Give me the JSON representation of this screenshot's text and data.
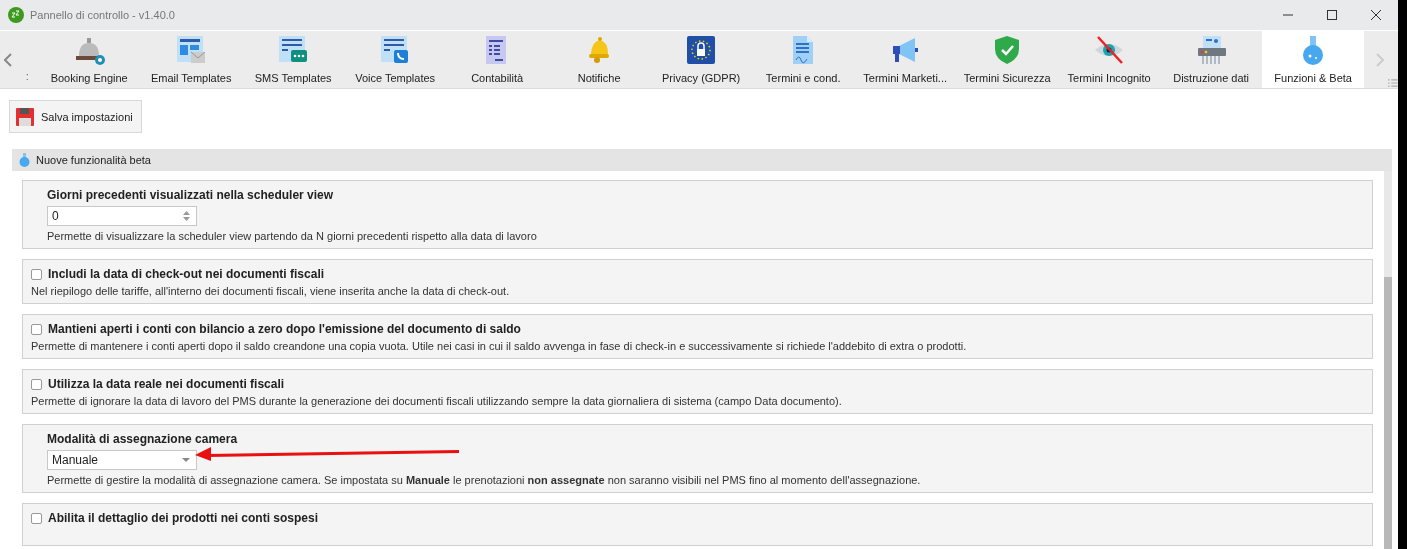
{
  "window": {
    "title": "Pannello di controllo - v1.40.0"
  },
  "tabs": [
    {
      "label": ":",
      "selected": false
    },
    {
      "label": "Booking Engine",
      "selected": false
    },
    {
      "label": "Email Templates",
      "selected": false
    },
    {
      "label": "SMS Templates",
      "selected": false
    },
    {
      "label": "Voice Templates",
      "selected": false
    },
    {
      "label": "Contabilità",
      "selected": false
    },
    {
      "label": "Notifiche",
      "selected": false
    },
    {
      "label": "Privacy (GDPR)",
      "selected": false
    },
    {
      "label": "Termini e cond.",
      "selected": false
    },
    {
      "label": "Termini Marketi...",
      "selected": false
    },
    {
      "label": "Termini Sicurezza",
      "selected": false
    },
    {
      "label": "Termini Incognito",
      "selected": false
    },
    {
      "label": "Distruzione dati",
      "selected": false
    },
    {
      "label": "Funzioni & Beta",
      "selected": true
    }
  ],
  "toolbar": {
    "save_button": "Salva impostazioni"
  },
  "group": {
    "title": "Nuove funzionalità beta"
  },
  "settings": [
    {
      "kind": "number",
      "title": "Giorni precedenti visualizzati nella scheduler view",
      "value": "0",
      "description": "Permette di visualizzare la scheduler view partendo da N giorni precedenti rispetto alla data di lavoro"
    },
    {
      "kind": "checkbox",
      "title": "Includi la data di check-out nei documenti fiscali",
      "checked": false,
      "description": "Nel riepilogo delle tariffe, all'interno dei documenti fiscali, viene inserita anche la data di check-out."
    },
    {
      "kind": "checkbox",
      "title": "Mantieni aperti i conti con bilancio a zero dopo l'emissione del documento di saldo",
      "checked": false,
      "description": "Permette di mantenere i conti aperti dopo il saldo creandone una copia vuota. Utile nei casi in cui il saldo avvenga in fase di check-in e successivamente si richiede l'addebito di extra o prodotti."
    },
    {
      "kind": "checkbox",
      "title": "Utilizza la data reale nei documenti fiscali",
      "checked": false,
      "description": "Permette di ignorare la data di lavoro del PMS durante la generazione dei documenti fiscali utilizzando sempre la data giornaliera di sistema (campo Data documento)."
    },
    {
      "kind": "select",
      "title": "Modalità di assegnazione camera",
      "value": "Manuale",
      "annotated": true,
      "description": "Permette di gestire la modalità di assegnazione camera. Se impostata su **Manuale** le prenotazioni **non assegnate** non saranno visibili nel PMS fino al momento dell'assegnazione."
    },
    {
      "kind": "checkbox",
      "title": "Abilita il dettaglio dei prodotti nei conti sospesi",
      "checked": false
    }
  ]
}
